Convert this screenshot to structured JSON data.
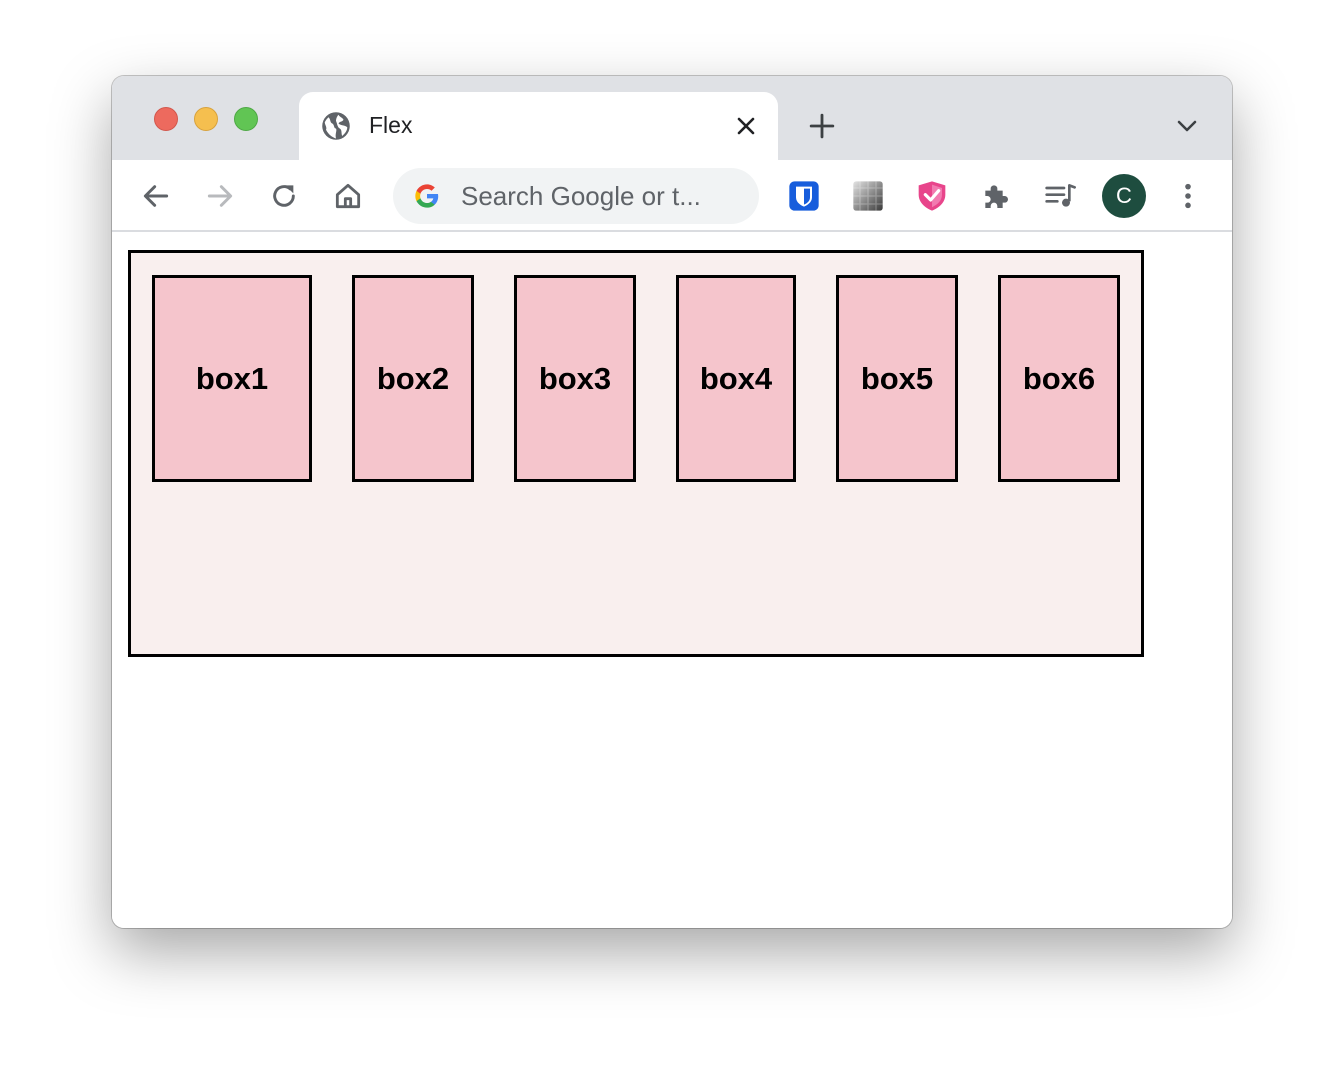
{
  "tab": {
    "title": "Flex"
  },
  "omnibox": {
    "placeholder": "Search Google or t..."
  },
  "profile": {
    "initial": "C",
    "color": "#1e4d3f"
  },
  "colors": {
    "container_bg": "#f9efee",
    "box_bg": "#f5c5cc",
    "border": "#000000"
  },
  "boxes": [
    {
      "label": "box1"
    },
    {
      "label": "box2"
    },
    {
      "label": "box3"
    },
    {
      "label": "box4"
    },
    {
      "label": "box5"
    },
    {
      "label": "box6"
    }
  ]
}
